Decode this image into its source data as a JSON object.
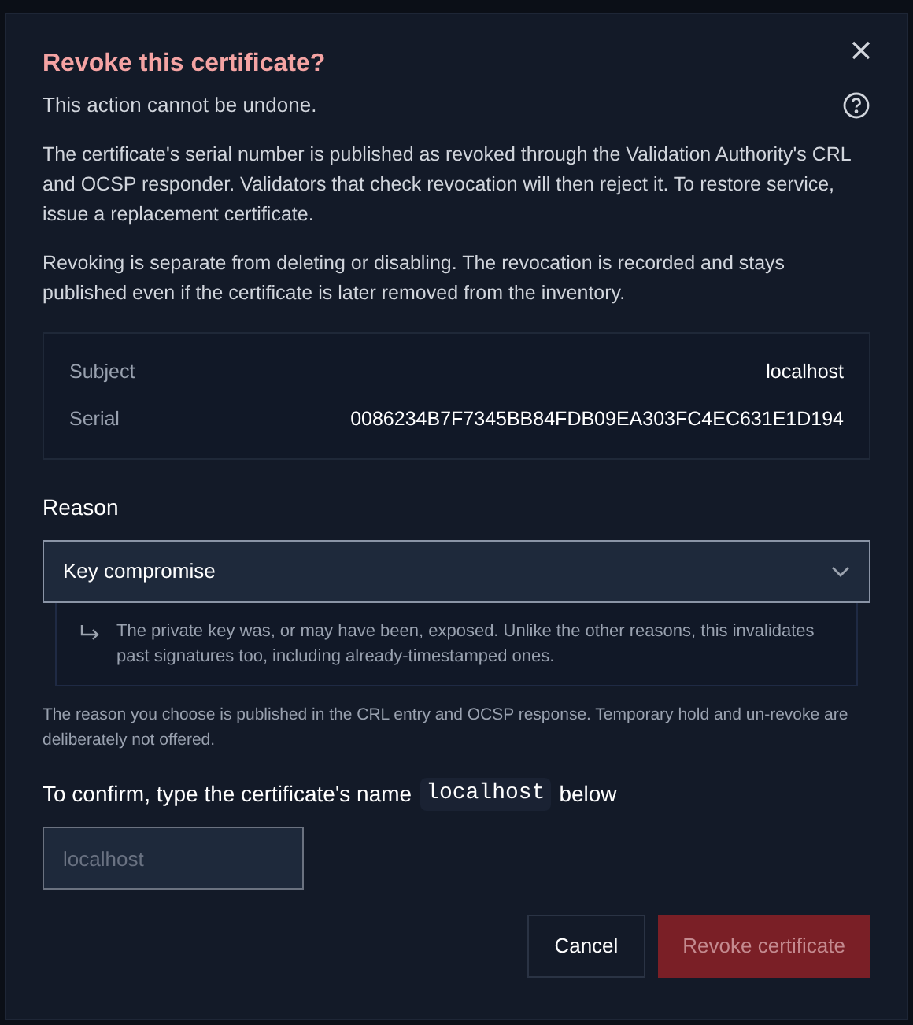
{
  "dialog": {
    "title": "Revoke this certificate?",
    "subtitle": "This action cannot be undone.",
    "paragraphs": [
      "The certificate's serial number is published as revoked through the Validation Authority's CRL and OCSP responder. Validators that check revocation will then reject it. To restore service, issue a replacement certificate.",
      "Revoking is separate from deleting or disabling. The revocation is recorded and stays published even if the certificate is later removed from the inventory."
    ],
    "details": [
      {
        "label": "Subject",
        "value": "localhost"
      },
      {
        "label": "Serial",
        "value": "0086234B7F7345BB84FDB09EA303FC4EC631E1D194"
      }
    ],
    "reason": {
      "label": "Reason",
      "value": "Key compromise",
      "description": "The private key was, or may have been, exposed. Unlike the other reasons, this invalidates past signatures too, including already-timestamped ones."
    },
    "note": "The reason you choose is published in the CRL entry and OCSP response. Temporary hold and un-revoke are deliberately not offered.",
    "confirm": {
      "before": "To confirm, type the certificate's name",
      "name": "localhost",
      "after": "below",
      "placeholder": "localhost"
    },
    "buttons": [
      {
        "label": "Cancel",
        "kind": "secondary",
        "disabled": false
      },
      {
        "label": "Revoke certificate",
        "kind": "danger",
        "disabled": true
      }
    ]
  }
}
